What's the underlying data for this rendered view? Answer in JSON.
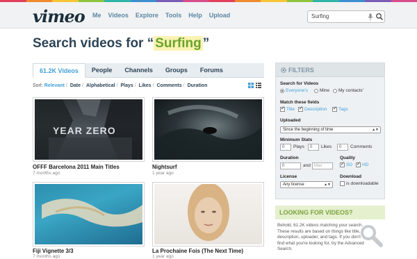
{
  "header": {
    "logo": "vimeo",
    "nav": [
      "Me",
      "Videos",
      "Explore",
      "Tools",
      "Help",
      "Upload"
    ],
    "search_value": "Surfing"
  },
  "page": {
    "title_prefix": "Search videos for “",
    "title_query": "Surfing",
    "title_suffix": "”"
  },
  "tabs": [
    "61.2K Videos",
    "People",
    "Channels",
    "Groups",
    "Forums"
  ],
  "sort": {
    "label": "Sort:",
    "options": [
      "Relevant",
      "Date",
      "Alphabetical",
      "Plays",
      "Likes",
      "Comments",
      "Duration"
    ]
  },
  "videos": [
    {
      "title": "OFFF Barcelona 2011 Main Titles",
      "meta": "7 months ago",
      "overlay": "YEAR ZERO"
    },
    {
      "title": "Nightsurf",
      "meta": "1 year ago",
      "overlay": ""
    },
    {
      "title": "Fiji Vignette 3/3",
      "meta": "7 months ago",
      "overlay": ""
    },
    {
      "title": "La Prochaine Fois (The Next Time)",
      "meta": "1 year ago",
      "overlay": ""
    }
  ],
  "filters": {
    "heading": "FILTERS",
    "search_for": {
      "label": "Search for Videos",
      "options": [
        "Everyone's",
        "Mine",
        "My contacts'"
      ],
      "selected": "Everyone's"
    },
    "match": {
      "label": "Match these fields",
      "options": [
        "Title",
        "Description",
        "Tags"
      ]
    },
    "uploaded": {
      "label": "Uploaded",
      "value": "Since the beginning of time"
    },
    "min_stats": {
      "label": "Minimum Stats",
      "plays_value": "0",
      "plays_label": "Plays",
      "likes_value": "0",
      "likes_label": "Likes",
      "comments_value": "0",
      "comments_label": "Comments"
    },
    "duration": {
      "label": "Duration",
      "min_value": "0",
      "and_label": "and",
      "max_placeholder": "Max"
    },
    "quality": {
      "label": "Quality",
      "options": [
        "SD",
        "HD"
      ]
    },
    "license": {
      "label": "License",
      "value": "Any license"
    },
    "download": {
      "label": "Download",
      "option": "is downloadable"
    }
  },
  "looking": {
    "heading": "LOOKING FOR VIDEOS?",
    "body": "Behold, 61.2K videos matching your search. These results are based on things like title, description, uploader, and tags. If you don't find what you're looking for, try the Advanced Search."
  },
  "colors": {
    "accent_blue": "#41a0d8",
    "title_navy": "#2d4456",
    "highlight_green": "#6aa22c",
    "stripe": [
      "#e23f5d",
      "#f08a2e",
      "#f7c535",
      "#8cc43f",
      "#2fb5a7",
      "#3b8fd0",
      "#7a5bb5",
      "#d94c8a"
    ]
  }
}
